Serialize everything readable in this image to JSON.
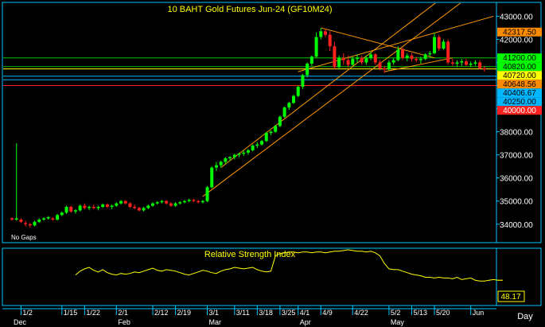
{
  "chart_data": [
    {
      "type": "candlestick",
      "title": "10 BAHT Gold Futures Jun-24 (GF10M24)",
      "note": "No Gaps",
      "timeframe": "Day",
      "ylim": [
        33200,
        43600
      ],
      "y_ticks": [
        34000,
        35000,
        36000,
        37000,
        38000,
        39000,
        40000,
        41000,
        42000,
        43000
      ],
      "y_tick_labels": [
        "34000.00",
        "35000.00",
        "36000.00",
        "37000.00",
        "38000.00",
        "39000.00",
        "40000.00",
        "41000.00",
        "42000.00",
        "43000.00"
      ],
      "x_ticks": [
        {
          "i": 2,
          "label": "1/2"
        },
        {
          "i": 11,
          "label": "1/15"
        },
        {
          "i": 16,
          "label": "1/22"
        },
        {
          "i": 23,
          "label": "2/1"
        },
        {
          "i": 31,
          "label": "2/12"
        },
        {
          "i": 36,
          "label": "2/19"
        },
        {
          "i": 43,
          "label": "3/1"
        },
        {
          "i": 49,
          "label": "3/11"
        },
        {
          "i": 54,
          "label": "3/18"
        },
        {
          "i": 59,
          "label": "3/25"
        },
        {
          "i": 63,
          "label": "4/1"
        },
        {
          "i": 68,
          "label": "4/9"
        },
        {
          "i": 75,
          "label": "4/22"
        },
        {
          "i": 83,
          "label": "5/2"
        },
        {
          "i": 88,
          "label": "5/13"
        },
        {
          "i": 93,
          "label": "5/20"
        },
        {
          "i": 101,
          "label": "Jun"
        }
      ],
      "month_labels": [
        {
          "i": 0,
          "label": "Dec"
        },
        {
          "i": 23,
          "label": "Feb"
        },
        {
          "i": 43,
          "label": "Mar"
        },
        {
          "i": 63,
          "label": "Apr"
        },
        {
          "i": 83,
          "label": "May"
        }
      ],
      "bars_ohlc": [
        [
          34250,
          34300,
          34150,
          34200
        ],
        [
          34200,
          37500,
          34150,
          34250
        ],
        [
          34200,
          34250,
          34050,
          34100
        ],
        [
          34050,
          34150,
          33900,
          34000
        ],
        [
          34000,
          34050,
          33850,
          33950
        ],
        [
          33950,
          34150,
          33900,
          34100
        ],
        [
          34100,
          34250,
          34050,
          34200
        ],
        [
          34200,
          34300,
          34150,
          34250
        ],
        [
          34250,
          34350,
          34200,
          34300
        ],
        [
          34250,
          34300,
          34150,
          34200
        ],
        [
          34200,
          34450,
          34150,
          34400
        ],
        [
          34400,
          34550,
          34350,
          34500
        ],
        [
          34500,
          34800,
          34450,
          34750
        ],
        [
          34750,
          34800,
          34500,
          34550
        ],
        [
          34550,
          34650,
          34450,
          34600
        ],
        [
          34600,
          34850,
          34550,
          34800
        ],
        [
          34800,
          34900,
          34650,
          34700
        ],
        [
          34700,
          34800,
          34600,
          34750
        ],
        [
          34750,
          34850,
          34650,
          34700
        ],
        [
          34700,
          34800,
          34600,
          34750
        ],
        [
          34750,
          34900,
          34700,
          34850
        ],
        [
          34850,
          34900,
          34700,
          34750
        ],
        [
          34750,
          34850,
          34650,
          34800
        ],
        [
          34800,
          34950,
          34750,
          34900
        ],
        [
          34900,
          35050,
          34850,
          35000
        ],
        [
          35000,
          35050,
          34850,
          34900
        ],
        [
          34900,
          34950,
          34700,
          34750
        ],
        [
          34750,
          34850,
          34650,
          34700
        ],
        [
          34700,
          34750,
          34550,
          34600
        ],
        [
          34600,
          34750,
          34550,
          34700
        ],
        [
          34700,
          34850,
          34650,
          34800
        ],
        [
          34800,
          34950,
          34750,
          34900
        ],
        [
          34900,
          35000,
          34850,
          34950
        ],
        [
          34950,
          35050,
          34900,
          35000
        ],
        [
          35000,
          35050,
          34850,
          34900
        ],
        [
          34900,
          34950,
          34750,
          34800
        ],
        [
          34800,
          34950,
          34750,
          34900
        ],
        [
          34900,
          35000,
          34850,
          34950
        ],
        [
          34950,
          35050,
          34900,
          35000
        ],
        [
          35000,
          35100,
          34950,
          35050
        ],
        [
          35050,
          35100,
          34950,
          35000
        ],
        [
          35000,
          35050,
          34900,
          34950
        ],
        [
          34950,
          35050,
          34900,
          35000
        ],
        [
          35000,
          35650,
          34950,
          35600
        ],
        [
          35600,
          36500,
          35550,
          36450
        ],
        [
          36450,
          36700,
          36300,
          36550
        ],
        [
          36550,
          36750,
          36450,
          36700
        ],
        [
          36700,
          36900,
          36600,
          36850
        ],
        [
          36850,
          36950,
          36750,
          36900
        ],
        [
          36900,
          37050,
          36800,
          37000
        ],
        [
          37000,
          37100,
          36900,
          37050
        ],
        [
          37050,
          37200,
          36950,
          37100
        ],
        [
          37100,
          37250,
          37000,
          37200
        ],
        [
          37200,
          37450,
          37150,
          37400
        ],
        [
          37400,
          37550,
          37300,
          37450
        ],
        [
          37450,
          37650,
          37400,
          37600
        ],
        [
          37600,
          38000,
          37550,
          37950
        ],
        [
          37950,
          38050,
          37850,
          38000
        ],
        [
          38000,
          38300,
          37950,
          38250
        ],
        [
          38250,
          38700,
          38200,
          38650
        ],
        [
          38650,
          39100,
          38600,
          39050
        ],
        [
          39050,
          39300,
          38950,
          39250
        ],
        [
          39250,
          39600,
          39200,
          39550
        ],
        [
          39550,
          40000,
          39500,
          39950
        ],
        [
          39950,
          40500,
          39850,
          40450
        ],
        [
          40450,
          41000,
          40350,
          40950
        ],
        [
          40950,
          41300,
          40850,
          41250
        ],
        [
          41250,
          42300,
          41200,
          42100
        ],
        [
          42100,
          42500,
          42000,
          42350
        ],
        [
          42350,
          42450,
          42100,
          42200
        ],
        [
          42200,
          42350,
          41500,
          41700
        ],
        [
          41700,
          41900,
          40700,
          40800
        ],
        [
          40800,
          41300,
          40700,
          41200
        ],
        [
          41200,
          41400,
          40900,
          41100
        ],
        [
          41100,
          41300,
          40800,
          40900
        ],
        [
          40900,
          41250,
          40850,
          41150
        ],
        [
          41150,
          41350,
          41000,
          41200
        ],
        [
          41200,
          41300,
          40900,
          41000
        ],
        [
          41000,
          41300,
          40900,
          41200
        ],
        [
          41200,
          41450,
          41100,
          41350
        ],
        [
          41350,
          41400,
          40900,
          41000
        ],
        [
          41000,
          41100,
          40650,
          40750
        ],
        [
          40750,
          40850,
          40550,
          40700
        ],
        [
          40700,
          41100,
          40650,
          41000
        ],
        [
          41000,
          41200,
          40900,
          41100
        ],
        [
          41100,
          41700,
          41050,
          41550
        ],
        [
          41550,
          41650,
          41100,
          41200
        ],
        [
          41200,
          41400,
          41050,
          41300
        ],
        [
          41300,
          41400,
          41050,
          41150
        ],
        [
          41150,
          41250,
          41000,
          41100
        ],
        [
          41100,
          41250,
          40950,
          41150
        ],
        [
          41150,
          41400,
          41100,
          41350
        ],
        [
          41350,
          41500,
          41250,
          41400
        ],
        [
          41400,
          42300,
          41350,
          42100
        ],
        [
          42100,
          42200,
          41500,
          41600
        ],
        [
          41600,
          42000,
          41550,
          41900
        ],
        [
          41900,
          42000,
          40900,
          41000
        ],
        [
          41000,
          41150,
          40850,
          40950
        ],
        [
          40950,
          41100,
          40800,
          41000
        ],
        [
          41000,
          41150,
          40850,
          41050
        ],
        [
          41050,
          41150,
          40850,
          40900
        ],
        [
          40900,
          41050,
          40800,
          40950
        ],
        [
          40950,
          41100,
          40850,
          41000
        ],
        [
          41000,
          41100,
          40700,
          40750
        ],
        [
          40750,
          40850,
          40600,
          40700
        ]
      ],
      "price_levels": [
        {
          "value": 42317.5,
          "label": "42317.50",
          "color": "#ff8c00"
        },
        {
          "value": 41200,
          "label": "41200.00",
          "color": "#00c000"
        },
        {
          "value": 40820,
          "label": "40820.00",
          "color": "#00c000"
        },
        {
          "value": 40720,
          "label": "40720.00",
          "color": "#ffff00"
        },
        {
          "value": 40648.56,
          "label": "40648.56",
          "color": "#ff8c00"
        },
        {
          "value": 40406.67,
          "label": "40406.67",
          "color": "#00b7ff"
        },
        {
          "value": 40250,
          "label": "40250.00",
          "color": "#00b7ff"
        },
        {
          "value": 40000,
          "label": "40000.00",
          "color": "#ff2020"
        }
      ],
      "trend_lines": [
        {
          "color": "#ff9900",
          "points": [
            [
              42,
              35200
            ],
            [
              103,
              44200
            ]
          ]
        },
        {
          "color": "#ff9900",
          "points": [
            [
              46,
              36450
            ],
            [
              106,
              45500
            ]
          ]
        },
        {
          "color": "#ff9900",
          "points": [
            [
              63,
              40600
            ],
            [
              106,
              43000
            ]
          ]
        },
        {
          "color": "#ff9900",
          "points": [
            [
              68,
              42500
            ],
            [
              93,
              41200
            ]
          ]
        },
        {
          "color": "#ff9900",
          "points": [
            [
              82,
              40600
            ],
            [
              97,
              41200
            ]
          ]
        }
      ],
      "colors": {
        "up": "#00ff00",
        "down": "#ff2020",
        "axis": "#00c8ff",
        "text": "#ffff00",
        "background": "#000000"
      }
    },
    {
      "type": "line",
      "title": "Relative Strength Index",
      "ylim": [
        15,
        90
      ],
      "last_value": 48.17,
      "last_value_label": "48.17",
      "series": [
        {
          "x_start": 14,
          "values": [
            55,
            60,
            63,
            65,
            61,
            59,
            62,
            58,
            56,
            55,
            57,
            56,
            57,
            59,
            58,
            60,
            62,
            64,
            61,
            60,
            62,
            61,
            60,
            58,
            56,
            55,
            57,
            59,
            61,
            60,
            58,
            57,
            60,
            62,
            63,
            65,
            64,
            63,
            64,
            65,
            62,
            60,
            59,
            60,
            80,
            83,
            84,
            85,
            85,
            84,
            85,
            85,
            84,
            85,
            85,
            84,
            85,
            86,
            86,
            87,
            88,
            87,
            86,
            86,
            85,
            86,
            84,
            80,
            70,
            63,
            62,
            62,
            60,
            58,
            56,
            55,
            54,
            52,
            52,
            51,
            52,
            51,
            51,
            50,
            52,
            49,
            50,
            51,
            48,
            47,
            47,
            48,
            49,
            48,
            48
          ],
          "color": "#ffff00"
        }
      ]
    }
  ]
}
